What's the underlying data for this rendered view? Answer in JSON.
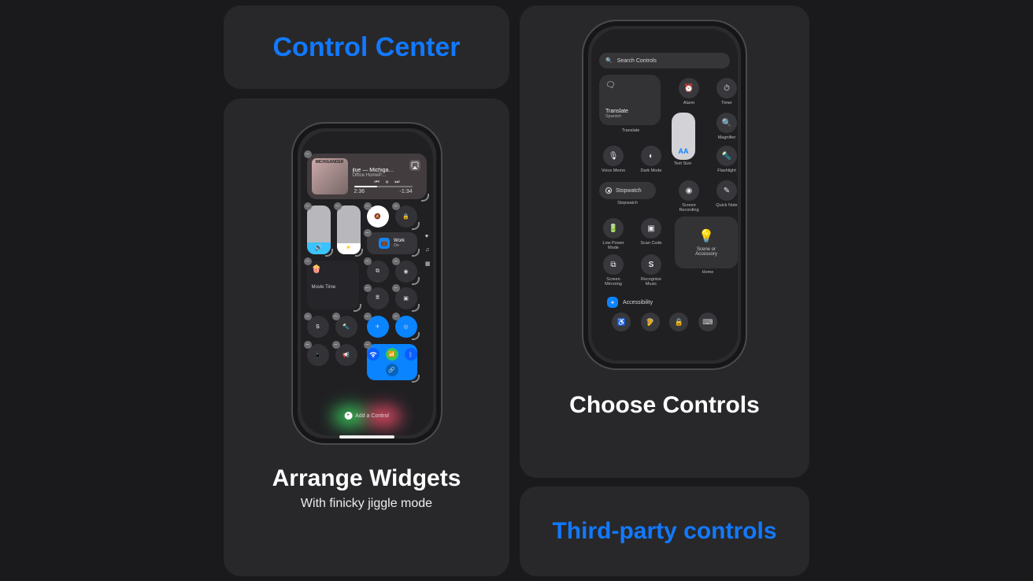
{
  "cards": {
    "control_center_title": "Control Center",
    "arrange": {
      "title": "Arrange Widgets",
      "subtitle": "With finicky jiggle mode"
    },
    "choose": {
      "title": "Choose Controls"
    },
    "third_party_title": "Third-party controls"
  },
  "colors": {
    "accent": "#1279ff"
  },
  "left_phone": {
    "now_playing": {
      "art_text": "MICHIGANDER",
      "title": "jlue — Michiga…",
      "subtitle": "Office HomeP…",
      "elapsed": "2:36",
      "remaining": "-1:34",
      "airplay_icon": "airplay-icon"
    },
    "sliders": {
      "volume_icon": "speaker-icon",
      "brightness_icon": "sun-icon"
    },
    "mute_icon": "bell-slash-icon",
    "lock_icon": "rotation-lock-icon",
    "work": {
      "label": "Work",
      "state": "On"
    },
    "movie_time": {
      "icon": "popcorn-icon",
      "label": "Movie Time"
    },
    "row_icons": {
      "mirroring": "mirroring-icon",
      "record": "record-icon",
      "calculator": "calculator-icon",
      "qr": "qr-icon",
      "shazam": "shazam-icon",
      "flashlight": "flashlight-icon",
      "airplane": "airplane-icon",
      "airdrop": "airdrop-icon",
      "remote": "remote-icon",
      "announce": "megaphone-icon"
    },
    "connectivity": {
      "wifi": "wifi-icon",
      "cellular": "cellular-icon",
      "bluetooth": "bluetooth-icon",
      "link": "link-icon"
    },
    "side_icons": {
      "heart": "heart-icon",
      "music": "music-icon",
      "grid": "grid-icon"
    },
    "add_control_label": "Add a Control"
  },
  "right_phone": {
    "search_placeholder": "Search Controls",
    "translate": {
      "title": "Translate",
      "subtitle": "Spanish",
      "caption": "Translate"
    },
    "cells": {
      "alarm": "Alarm",
      "timer": "Timer",
      "magnifier": "Magnifier",
      "voice_memo": "Voice Memo",
      "dark_mode": "Dark Mode",
      "text_size": "Text Size",
      "flashlight": "Flashlight",
      "stopwatch_caption": "Stopwatch",
      "screen_recording": "Screen\nRecording",
      "quick_note": "Quick Note",
      "low_power": "Low Power\nMode",
      "scan_code": "Scan Code",
      "scene": "Scene or\nAccessory",
      "screen_mirroring": "Screen\nMirroring",
      "recognize_music": "Recognize\nMusic",
      "home_caption": "Home"
    },
    "text_size_AA": "AA",
    "stopwatch_label": "Stopwatch",
    "section_accessibility": "Accessibility"
  }
}
